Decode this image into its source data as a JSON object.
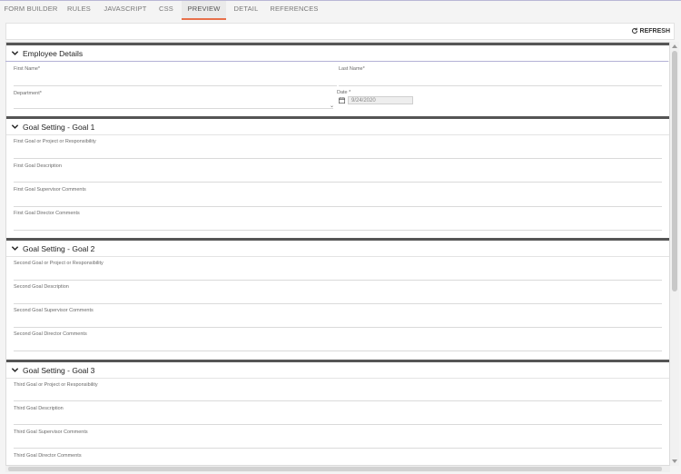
{
  "tabs": [
    {
      "label": "FORM BUILDER",
      "active": false
    },
    {
      "label": "RULES",
      "active": false
    },
    {
      "label": "JAVASCRIPT",
      "active": false
    },
    {
      "label": "CSS",
      "active": false
    },
    {
      "label": "PREVIEW",
      "active": true
    },
    {
      "label": "DETAIL",
      "active": false
    },
    {
      "label": "REFERENCES",
      "active": false
    }
  ],
  "toolbar": {
    "refresh_label": "REFRESH"
  },
  "sections": {
    "employee": {
      "title": "Employee Details",
      "first_name_label": "First Name*",
      "last_name_label": "Last Name*",
      "department_label": "Department*",
      "date_label": "Date *",
      "date_value": "9/24/2020"
    },
    "goal1": {
      "title": "Goal Setting - Goal 1",
      "fields": [
        "First Goal or Project or Responsibility",
        "First Goal Description",
        "First Goal Supervisor Comments",
        "First Goal Director Comments"
      ]
    },
    "goal2": {
      "title": "Goal Setting - Goal 2",
      "fields": [
        "Second Goal or Project or Responsibility",
        "Second Goal Description",
        "Second Goal Supervisor Comments",
        "Second Goal Director Comments"
      ]
    },
    "goal3": {
      "title": "Goal Setting - Goal 3",
      "fields": [
        "Third Goal or Project or Responsibility",
        "Third Goal Description",
        "Third Goal Supervisor Comments",
        "Third Goal Director Comments"
      ]
    }
  },
  "colors": {
    "accent": "#e8704a",
    "section_bar": "#555555"
  }
}
